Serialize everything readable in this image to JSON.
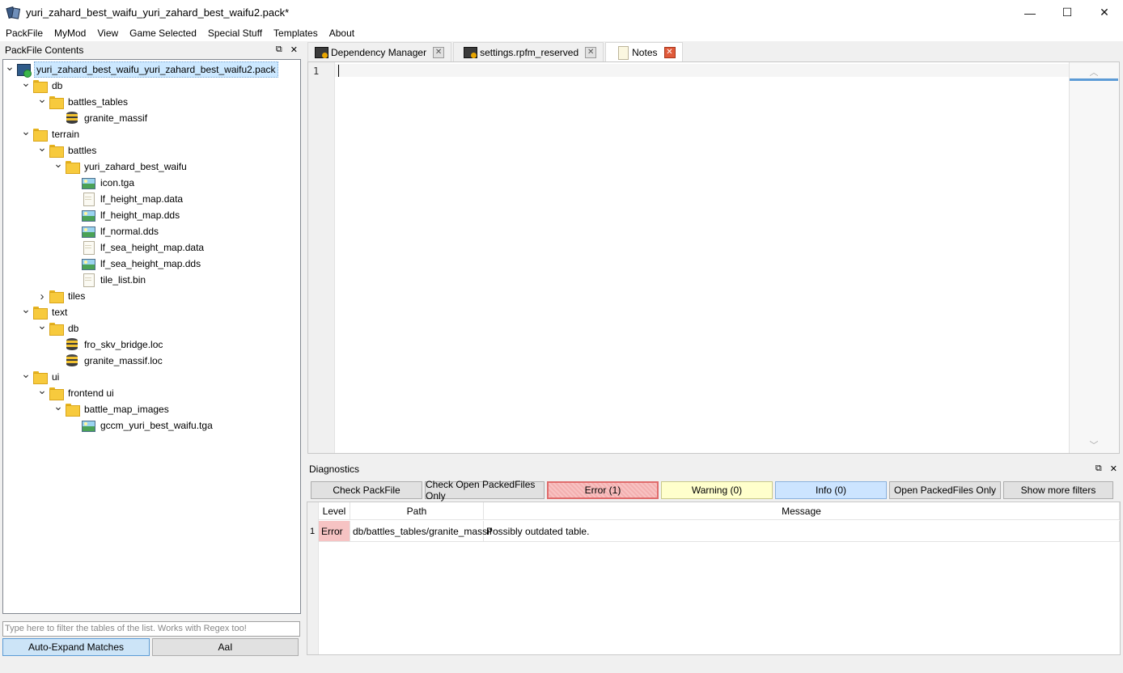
{
  "window": {
    "title": "yuri_zahard_best_waifu_yuri_zahard_best_waifu2.pack*",
    "minimize": "—",
    "maximize": "☐",
    "close": "✕"
  },
  "menu": [
    "PackFile",
    "MyMod",
    "View",
    "Game Selected",
    "Special Stuff",
    "Templates",
    "About"
  ],
  "packfile_panel": {
    "title": "PackFile Contents",
    "float_icon": "⧉",
    "close_icon": "✕",
    "tree": [
      {
        "label": "yuri_zahard_best_waifu_yuri_zahard_best_waifu2.pack",
        "icon": "pack-icon",
        "depth": 0,
        "expander": "open",
        "selected": true
      },
      {
        "label": "db",
        "icon": "folder-icon",
        "depth": 1,
        "expander": "open"
      },
      {
        "label": "battles_tables",
        "icon": "folder-icon",
        "depth": 2,
        "expander": "open"
      },
      {
        "label": "granite_massif",
        "icon": "db-icon",
        "depth": 3,
        "expander": "none"
      },
      {
        "label": "terrain",
        "icon": "folder-icon",
        "depth": 1,
        "expander": "open"
      },
      {
        "label": "battles",
        "icon": "folder-icon",
        "depth": 2,
        "expander": "open"
      },
      {
        "label": "yuri_zahard_best_waifu",
        "icon": "folder-icon",
        "depth": 3,
        "expander": "open"
      },
      {
        "label": "icon.tga",
        "icon": "image-icon",
        "depth": 4,
        "expander": "none"
      },
      {
        "label": "lf_height_map.data",
        "icon": "file-icon",
        "depth": 4,
        "expander": "none"
      },
      {
        "label": "lf_height_map.dds",
        "icon": "image-icon",
        "depth": 4,
        "expander": "none"
      },
      {
        "label": "lf_normal.dds",
        "icon": "image-icon",
        "depth": 4,
        "expander": "none"
      },
      {
        "label": "lf_sea_height_map.data",
        "icon": "file-icon",
        "depth": 4,
        "expander": "none"
      },
      {
        "label": "lf_sea_height_map.dds",
        "icon": "image-icon",
        "depth": 4,
        "expander": "none"
      },
      {
        "label": "tile_list.bin",
        "icon": "file-icon",
        "depth": 4,
        "expander": "none"
      },
      {
        "label": "tiles",
        "icon": "folder-icon",
        "depth": 2,
        "expander": "closed"
      },
      {
        "label": "text",
        "icon": "folder-icon",
        "depth": 1,
        "expander": "open"
      },
      {
        "label": "db",
        "icon": "folder-icon",
        "depth": 2,
        "expander": "open"
      },
      {
        "label": "fro_skv_bridge.loc",
        "icon": "db-icon",
        "depth": 3,
        "expander": "none"
      },
      {
        "label": "granite_massif.loc",
        "icon": "db-icon",
        "depth": 3,
        "expander": "none"
      },
      {
        "label": "ui",
        "icon": "folder-icon",
        "depth": 1,
        "expander": "open"
      },
      {
        "label": "frontend ui",
        "icon": "folder-icon",
        "depth": 2,
        "expander": "open"
      },
      {
        "label": "battle_map_images",
        "icon": "folder-icon",
        "depth": 3,
        "expander": "open"
      },
      {
        "label": "gccm_yuri_best_waifu.tga",
        "icon": "image-icon",
        "depth": 4,
        "expander": "none"
      }
    ],
    "filter_placeholder": "Type here to filter the tables of the list. Works with Regex too!",
    "auto_expand_label": "Auto-Expand Matches",
    "case_label": "AaI"
  },
  "tabs": [
    {
      "label": "Dependency Manager",
      "icon": "terminal-icon",
      "active": false
    },
    {
      "label": "settings.rpfm_reserved",
      "icon": "terminal-icon",
      "active": false
    },
    {
      "label": "Notes",
      "icon": "note-icon",
      "active": true
    }
  ],
  "editor": {
    "line_number": "1",
    "content": "",
    "scroll_up": "︿",
    "scroll_down": "﹀"
  },
  "diagnostics": {
    "title": "Diagnostics",
    "float_icon": "⧉",
    "close_icon": "✕",
    "buttons": {
      "check_packfile": "Check PackFile",
      "check_open": "Check Open PackedFiles Only",
      "error": "Error (1)",
      "warning": "Warning (0)",
      "info": "Info (0)",
      "open_only": "Open PackedFiles Only",
      "more_filters": "Show more filters"
    },
    "columns": [
      "Level",
      "Path",
      "Message"
    ],
    "rows": [
      {
        "num": "1",
        "level": "Error",
        "path": "db/battles_tables/granite_massif",
        "message": "Possibly outdated table."
      }
    ]
  },
  "colors": {
    "selection": "#cce8ff",
    "error_bg": "#f6c3c3",
    "warning_bg": "#ffffcc",
    "info_bg": "#cce4ff",
    "accent": "#5c9bd6"
  }
}
